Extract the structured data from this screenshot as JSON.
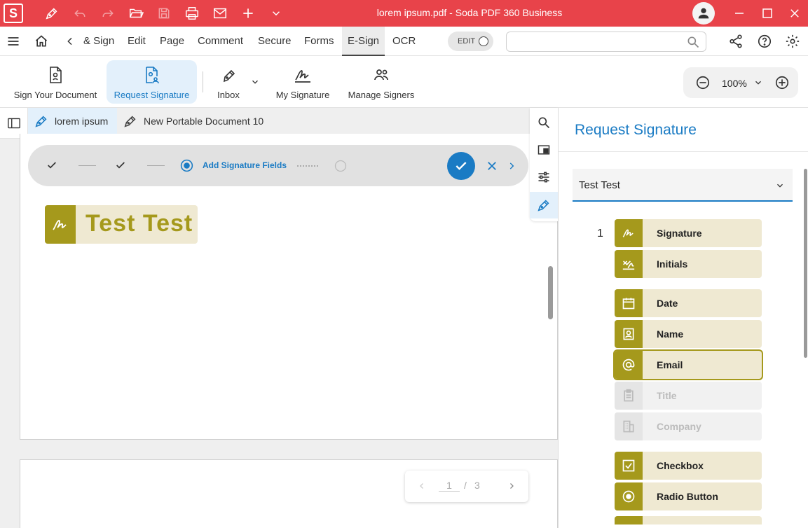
{
  "titlebar": {
    "logo": "S",
    "title": "lorem ipsum.pdf   -   Soda PDF 360 Business",
    "icons": [
      "pen-icon",
      "undo-icon",
      "redo-icon",
      "open-folder-icon",
      "save-icon",
      "print-icon",
      "mail-icon",
      "plus-icon",
      "chevron-down-icon"
    ],
    "window_controls": [
      "minimize-icon",
      "maximize-icon",
      "close-icon"
    ]
  },
  "menubar": {
    "items": [
      {
        "label": "& Sign"
      },
      {
        "label": "Edit"
      },
      {
        "label": "Page"
      },
      {
        "label": "Comment"
      },
      {
        "label": "Secure"
      },
      {
        "label": "Forms"
      },
      {
        "label": "E-Sign"
      },
      {
        "label": "OCR"
      }
    ],
    "active": "E-Sign",
    "edit_toggle": "EDIT",
    "search_placeholder": ""
  },
  "ribbon": {
    "buttons": [
      {
        "label": "Sign Your Document",
        "icon": "document-sign-icon"
      },
      {
        "label": "Request Signature",
        "icon": "request-signature-icon"
      },
      {
        "label": "Inbox",
        "icon": "inbox-pen-icon"
      },
      {
        "label": "My Signature",
        "icon": "signature-icon"
      },
      {
        "label": "Manage Signers",
        "icon": "users-icon"
      }
    ],
    "zoom": "100%"
  },
  "tabs": [
    {
      "label": "lorem ipsum"
    },
    {
      "label": "New Portable Document 10"
    }
  ],
  "steps": {
    "current_label": "Add Signature Fields"
  },
  "document": {
    "signature_field_name": "Test Test"
  },
  "pager": {
    "current": "1",
    "sep": "/",
    "total": "3"
  },
  "panel": {
    "title": "Request Signature",
    "signer": "Test Test",
    "signer_number": "1",
    "fields": [
      {
        "label": "Signature",
        "icon": "signature-icon",
        "state": "enabled"
      },
      {
        "label": "Initials",
        "icon": "initials-icon",
        "state": "enabled"
      },
      {
        "label": "Date",
        "icon": "calendar-icon",
        "state": "enabled"
      },
      {
        "label": "Name",
        "icon": "name-card-icon",
        "state": "enabled"
      },
      {
        "label": "Email",
        "icon": "at-icon",
        "state": "selected"
      },
      {
        "label": "Title",
        "icon": "clipboard-icon",
        "state": "disabled"
      },
      {
        "label": "Company",
        "icon": "building-icon",
        "state": "disabled"
      },
      {
        "label": "Checkbox",
        "icon": "checkbox-icon",
        "state": "enabled"
      },
      {
        "label": "Radio Button",
        "icon": "radio-icon",
        "state": "enabled"
      }
    ]
  },
  "colors": {
    "titlebar": "#e8434a",
    "accent": "#1a7bc4",
    "field_olive": "#a5991c",
    "field_bg": "#efe9d2"
  }
}
